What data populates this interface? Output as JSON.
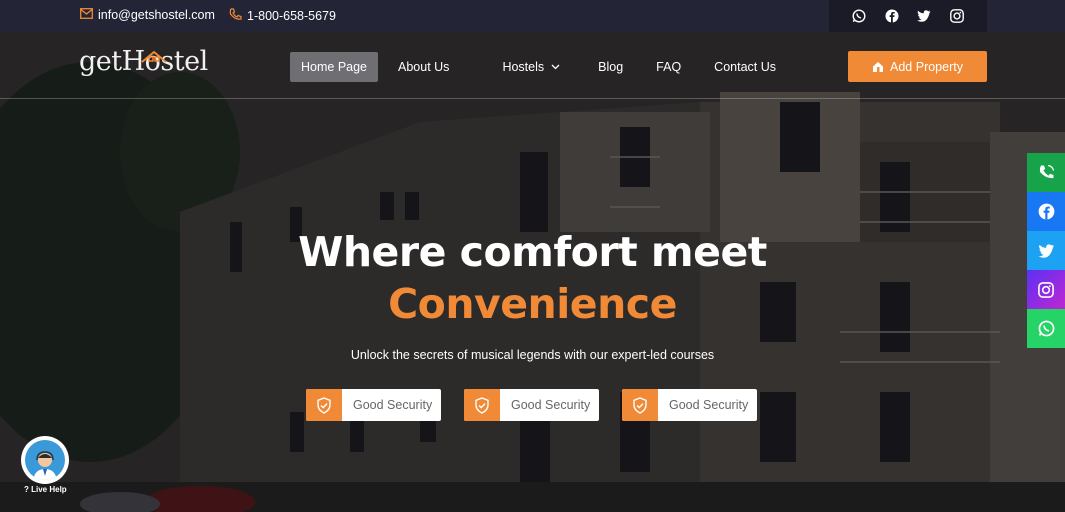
{
  "topbar": {
    "email": "info@getshostel.com",
    "phone": "1-800-658-5679",
    "social_icons": [
      "whatsapp-icon",
      "facebook-icon",
      "twitter-icon",
      "instagram-icon"
    ]
  },
  "brand": {
    "logo_text": "getHostel"
  },
  "nav": {
    "items": [
      {
        "label": "Home Page",
        "active": true
      },
      {
        "label": "About Us"
      },
      {
        "label": "Hostels",
        "dropdown": true
      },
      {
        "label": "Blog"
      },
      {
        "label": "FAQ"
      },
      {
        "label": "Contact Us"
      }
    ],
    "cta_label": "Add Property"
  },
  "hero": {
    "title_line1": "Where comfort meet",
    "title_line2": "Convenience",
    "subtitle": "Unlock the secrets of musical legends with our expert-led courses",
    "features": [
      {
        "label": "Good Security",
        "icon": "shield-check-icon"
      },
      {
        "label": "Good Security",
        "icon": "shield-check-icon"
      },
      {
        "label": "Good Security",
        "icon": "shield-check-icon"
      }
    ]
  },
  "floating_social": [
    {
      "icon": "phone-icon",
      "color": "#17a34a"
    },
    {
      "icon": "facebook-icon",
      "color": "#1877f2"
    },
    {
      "icon": "twitter-icon",
      "color": "#1da1f2"
    },
    {
      "icon": "instagram-icon",
      "color": "#a82bd6"
    },
    {
      "icon": "whatsapp-icon",
      "color": "#25d366"
    }
  ],
  "live_help": {
    "label": "Live Help"
  },
  "colors": {
    "accent": "#f18a36",
    "topbar": "#232536"
  }
}
